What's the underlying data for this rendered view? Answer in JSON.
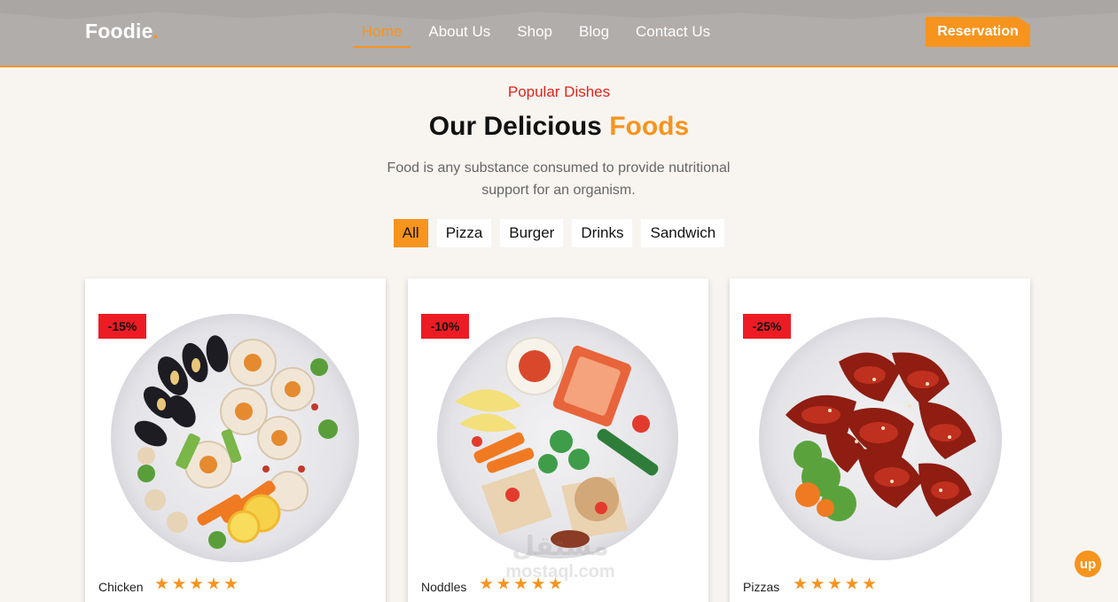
{
  "header": {
    "logo": "Foodie",
    "logo_dot": ".",
    "nav": [
      "Home",
      "About Us",
      "Shop",
      "Blog",
      "Contact Us"
    ],
    "active_nav": "Home",
    "reservation_label": "Reservation"
  },
  "section": {
    "kicker": "Popular Dishes",
    "title_main": "Our Delicious ",
    "title_accent": "Foods",
    "description": "Food is any substance consumed to provide nutritional support for an organism."
  },
  "filters": [
    "All",
    "Pizza",
    "Burger",
    "Drinks",
    "Sandwich"
  ],
  "active_filter": "All",
  "cards": [
    {
      "discount": "-15%",
      "name": "Chicken",
      "rating": 5,
      "rating_max": 5
    },
    {
      "discount": "-10%",
      "name": "Noddles",
      "rating": 5,
      "rating_max": 5
    },
    {
      "discount": "-25%",
      "name": "Pizzas",
      "rating": 5,
      "rating_max": 5
    }
  ],
  "watermark": {
    "arabic": "مستقل",
    "latin": "mostaql.com"
  },
  "up_button": "up",
  "colors": {
    "accent": "#f7941d",
    "kicker": "#e2231a",
    "badge": "#ed1c24",
    "header_bg": "#b0adab",
    "page_bg": "#f8f5f1"
  },
  "icons": [
    "star-icon"
  ]
}
